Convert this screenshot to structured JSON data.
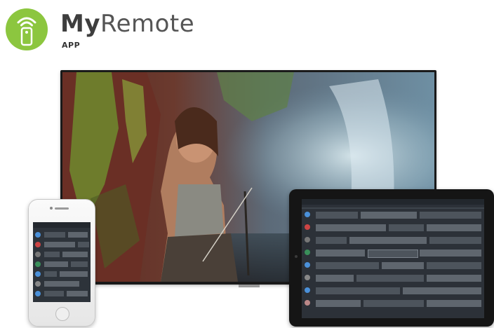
{
  "app": {
    "brand_bold": "My",
    "brand_light": "Remote",
    "subtitle": "APP",
    "logo_icon": "remote-wifi-icon",
    "accent": "#8cc63f"
  },
  "devices": {
    "tv_image": "tv-movie-scene",
    "phone_content": "epg-grid",
    "tablet_content": "epg-grid"
  }
}
